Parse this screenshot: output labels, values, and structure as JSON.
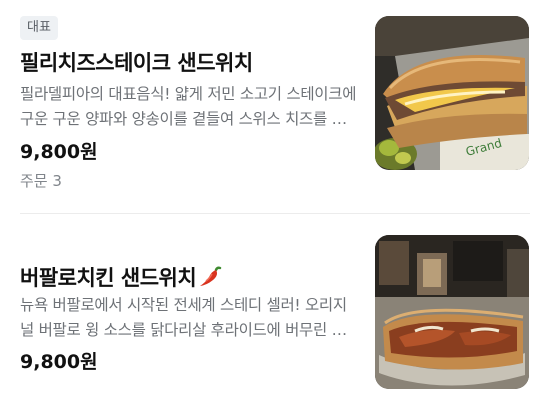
{
  "items": [
    {
      "badge": "대표",
      "name": "필리치즈스테이크 샌드위치",
      "description": "필라델피아의 대표음식! 얇게 저민 소고기 스테이크에 구운 구운 양파와 양송이를 곁들여 스위스 치즈를 녹여낸 샌드위치",
      "price": "9,800원",
      "orders": "주문 3"
    },
    {
      "name": "버팔로치킨 샌드위치",
      "description": "뉴욕 버팔로에서 시작된 전세계 스테디 셀러! 오리지널 버팔로 윙 소스를 닭다리살 후라이드에 버무린 샌드위치",
      "price": "9,800원"
    }
  ],
  "colors": {
    "divider": "#ececec",
    "badge_bg": "#eef1f4",
    "description": "#6e7277",
    "pepper": "#d9331f"
  }
}
